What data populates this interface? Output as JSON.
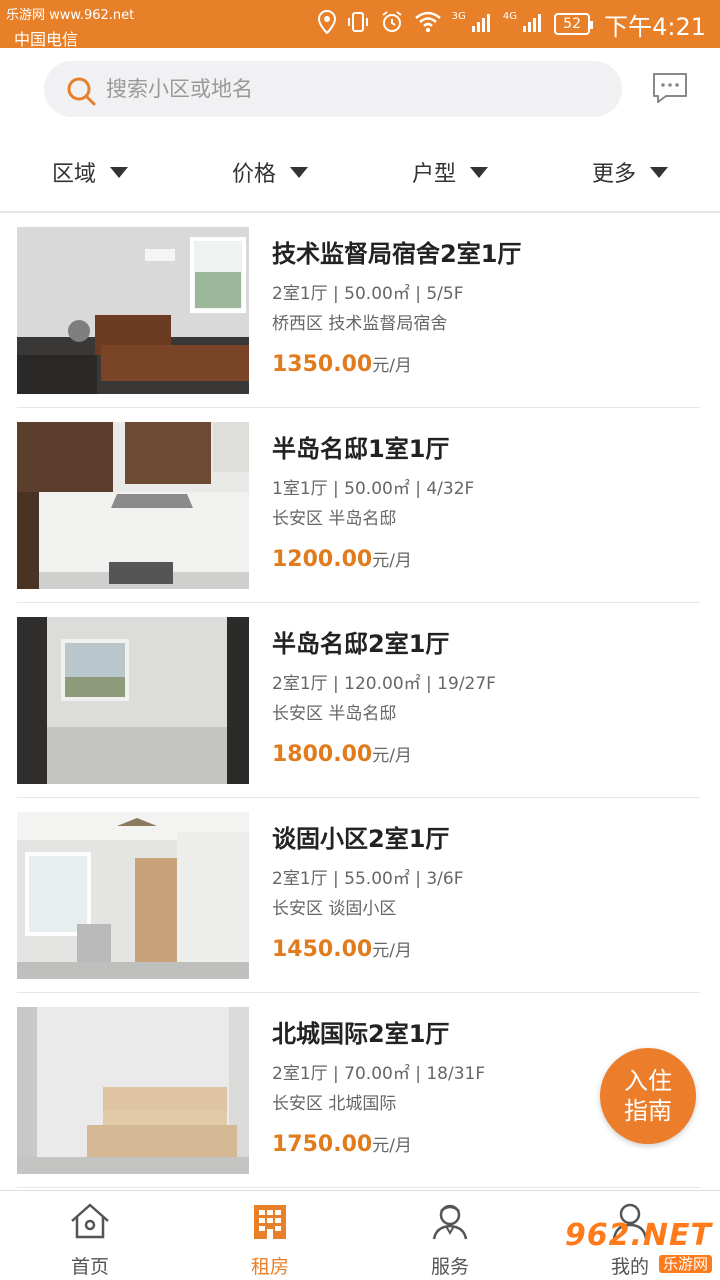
{
  "status_bar": {
    "watermark": "乐游网 www.962.net",
    "carrier": "中国电信",
    "network_3g": "3G",
    "network_4g": "4G",
    "battery": "52",
    "time": "下午4:21"
  },
  "search": {
    "placeholder": "搜索小区或地名"
  },
  "filters": [
    {
      "label": "区域"
    },
    {
      "label": "价格"
    },
    {
      "label": "户型"
    },
    {
      "label": "更多"
    }
  ],
  "listings": [
    {
      "title": "技术监督局宿舍2室1厅",
      "specs": "2室1厅 | 50.00㎡ | 5/5F",
      "address": "桥西区 技术监督局宿舍",
      "price": "1350.00",
      "unit": "元/月"
    },
    {
      "title": "半岛名邸1室1厅",
      "specs": "1室1厅 | 50.00㎡ | 4/32F",
      "address": "长安区 半岛名邸",
      "price": "1200.00",
      "unit": "元/月"
    },
    {
      "title": "半岛名邸2室1厅",
      "specs": "2室1厅 | 120.00㎡ | 19/27F",
      "address": "长安区 半岛名邸",
      "price": "1800.00",
      "unit": "元/月"
    },
    {
      "title": "谈固小区2室1厅",
      "specs": "2室1厅 | 55.00㎡ | 3/6F",
      "address": "长安区 谈固小区",
      "price": "1450.00",
      "unit": "元/月"
    },
    {
      "title": "北城国际2室1厅",
      "specs": "2室1厅 | 70.00㎡ | 18/31F",
      "address": "长安区 北城国际",
      "price": "1750.00",
      "unit": "元/月"
    }
  ],
  "guide_button": {
    "line1": "入住",
    "line2": "指南"
  },
  "bottom_nav": [
    {
      "label": "首页",
      "icon": "home-icon"
    },
    {
      "label": "租房",
      "icon": "building-icon",
      "active": true
    },
    {
      "label": "服务",
      "icon": "service-person-icon"
    },
    {
      "label": "我的",
      "icon": "profile-icon"
    }
  ],
  "watermark_962": {
    "big": "962.NET",
    "small": "乐游网"
  },
  "colors": {
    "accent": "#e8802a",
    "price": "#e07c1d"
  }
}
